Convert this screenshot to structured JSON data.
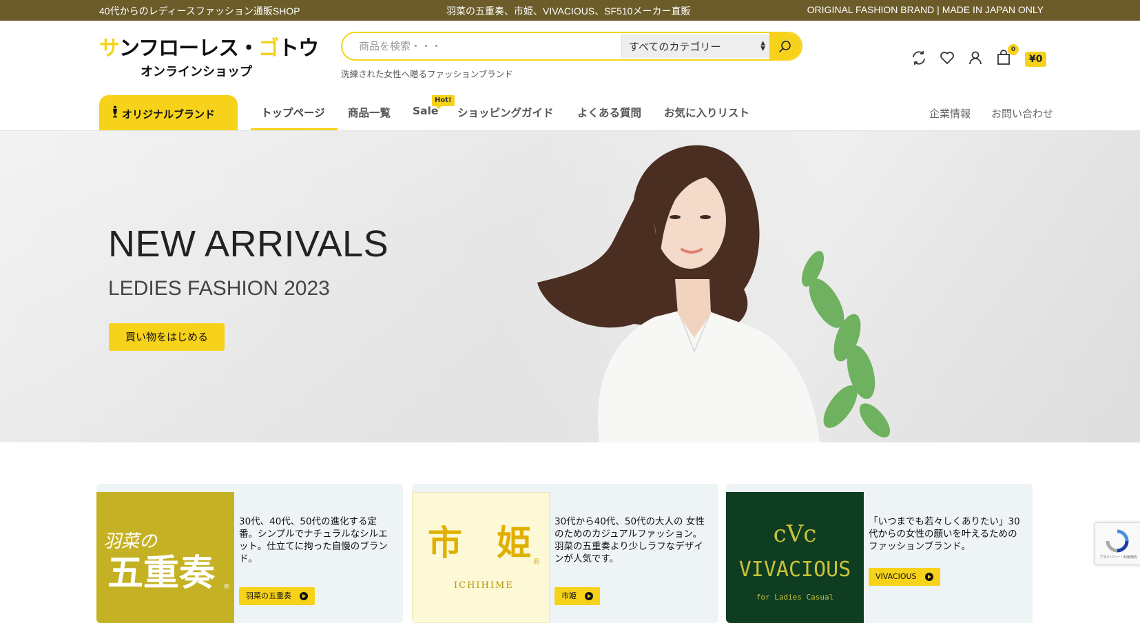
{
  "topbar": {
    "left": "40代からのレディースファッション通販SHOP",
    "center": "羽菜の五重奏、市姫、VIVACIOUS、SF510メーカー直販",
    "right": "ORIGINAL FASHION BRAND | MADE IN JAPAN ONLY"
  },
  "header": {
    "logo_main_a": "サ",
    "logo_main_b": "ンフローレス・",
    "logo_main_c": "ゴ",
    "logo_main_d": "トウ",
    "logo_sub": "オンラインショップ",
    "search_placeholder": "商品を検索・・・",
    "category_selected": "すべてのカテゴリー",
    "tagline": "洗練された女性へ贈るファッションブランド",
    "cart_count": "0",
    "cart_total": "¥0",
    "icons": [
      "refresh-icon",
      "heart-icon",
      "user-icon",
      "bag-icon",
      "search-icon"
    ]
  },
  "nav": {
    "brand_tab": "オリジナルブランド",
    "items": [
      "トップページ",
      "商品一覧",
      "Sale",
      "ショッピングガイド",
      "よくある質問",
      "お気に入りリスト"
    ],
    "hot_badge": "Hot!",
    "right_items": [
      "企業情報",
      "お問い合わせ"
    ]
  },
  "hero": {
    "title": "NEW ARRIVALS",
    "subtitle": "LEDIES FASHION 2023",
    "cta": "買い物をはじめる"
  },
  "cards": [
    {
      "logo_text_a": "羽菜の",
      "logo_text_b": "五重奏",
      "desc": "30代、40代、50代の進化する定番。シンプルでナチュラルなシルエット。仕立てに拘った自慢のブランド。",
      "button": "羽菜の五重奏"
    },
    {
      "logo_text_a": "市　姫",
      "logo_text_b": "ICHIHIME",
      "desc": "30代から40代、50代の大人の 女性のためのカジュアルファッション。羽菜の五重奏より少しラフなデザインが人気です。",
      "button": "市姫"
    },
    {
      "logo_text_a": "cVc",
      "logo_text_b": "VIVACIOUS",
      "logo_text_c": "for Ladies Casual",
      "desc": "「いつまでも若々しくありたい」30代からの女性の願いを叶えるためのファッションブランド。",
      "button": "VIVACIOUS"
    }
  ],
  "recaptcha": {
    "text": "プライバシー・利用規約"
  },
  "colors": {
    "accent": "#f7d21a",
    "topbar": "#6b5c2a"
  }
}
